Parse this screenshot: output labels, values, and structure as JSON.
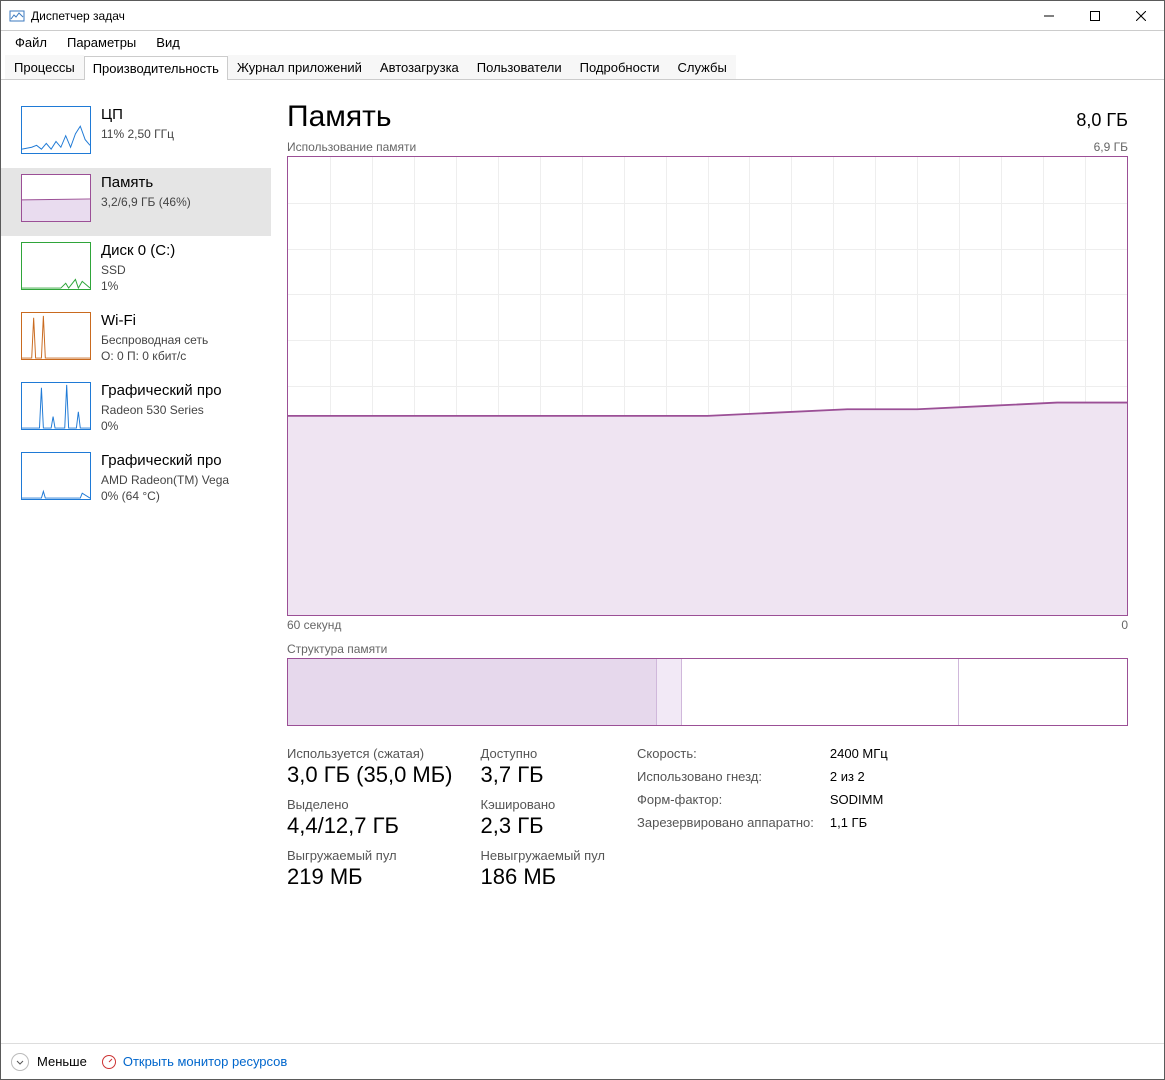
{
  "window": {
    "title": "Диспетчер задач"
  },
  "menu": {
    "file": "Файл",
    "options": "Параметры",
    "view": "Вид"
  },
  "tabs": {
    "processes": "Процессы",
    "performance": "Производительность",
    "apphistory": "Журнал приложений",
    "startup": "Автозагрузка",
    "users": "Пользователи",
    "details": "Подробности",
    "services": "Службы"
  },
  "sidebar": {
    "cpu": {
      "title": "ЦП",
      "sub": "11%  2,50 ГГц",
      "color": "#1f7ad6"
    },
    "mem": {
      "title": "Память",
      "sub": "3,2/6,9 ГБ (46%)",
      "color": "#9b4f96"
    },
    "disk": {
      "title": "Диск 0 (C:)",
      "sub1": "SSD",
      "sub2": "1%",
      "color": "#2fa53a"
    },
    "wifi": {
      "title": "Wi-Fi",
      "sub1": "Беспроводная сеть",
      "sub2": "О: 0  П: 0 кбит/с",
      "color": "#c96a1f"
    },
    "gpu0": {
      "title": "Графический про",
      "sub1": "Radeon 530 Series",
      "sub2": "0%",
      "color": "#1f7ad6"
    },
    "gpu1": {
      "title": "Графический про",
      "sub1": "AMD Radeon(TM) Vega",
      "sub2": "0%  (64 °C)",
      "color": "#1f7ad6"
    }
  },
  "panel": {
    "title": "Память",
    "total": "8,0 ГБ",
    "chart_top_left": "Использование памяти",
    "chart_top_right": "6,9 ГБ",
    "chart_bottom_left": "60 секунд",
    "chart_bottom_right": "0",
    "struct_label": "Структура памяти"
  },
  "stats_left": {
    "used_label": "Используется (сжатая)",
    "used_value": "3,0 ГБ (35,0 МБ)",
    "avail_label": "Доступно",
    "avail_value": "3,7 ГБ",
    "commit_label": "Выделено",
    "commit_value": "4,4/12,7 ГБ",
    "cached_label": "Кэшировано",
    "cached_value": "2,3 ГБ",
    "paged_label": "Выгружаемый пул",
    "paged_value": "219 МБ",
    "nonpaged_label": "Невыгружаемый пул",
    "nonpaged_value": "186 МБ"
  },
  "stats_right": {
    "speed_label": "Скорость:",
    "speed_value": "2400 МГц",
    "slots_label": "Использовано гнезд:",
    "slots_value": "2 из 2",
    "form_label": "Форм-фактор:",
    "form_value": "SODIMM",
    "hw_label": "Зарезервировано аппаратно:",
    "hw_value": "1,1 ГБ"
  },
  "footer": {
    "less": "Меньше",
    "link": "Открыть монитор ресурсов"
  },
  "chart_data": {
    "type": "area",
    "title": "Использование памяти",
    "xlabel": "60 секунд → 0",
    "ylabel": "ГБ",
    "ylim": [
      0,
      6.9
    ],
    "x_seconds": [
      60,
      55,
      50,
      45,
      40,
      35,
      30,
      25,
      20,
      15,
      10,
      5,
      0
    ],
    "values": [
      3.0,
      3.0,
      3.0,
      3.0,
      3.0,
      3.0,
      3.0,
      3.05,
      3.1,
      3.1,
      3.15,
      3.2,
      3.2
    ]
  }
}
